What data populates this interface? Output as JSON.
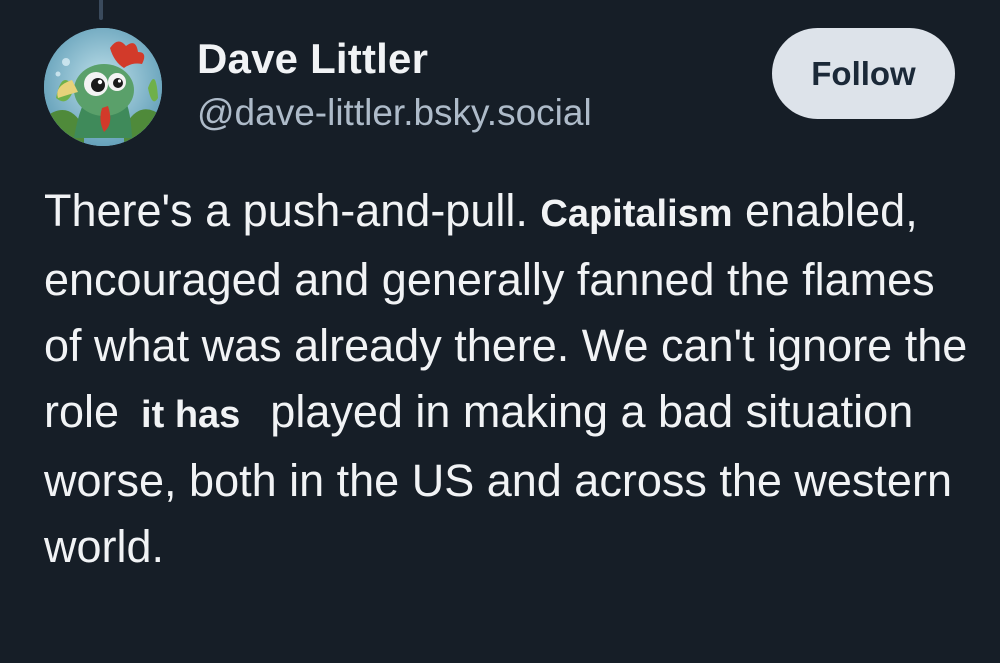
{
  "author": {
    "display_name": "Dave Littler",
    "handle": "@dave-littler.bsky.social"
  },
  "follow_button": {
    "label": "Follow"
  },
  "post": {
    "segments": [
      {
        "text": "There's a push-and-pull. ",
        "bold": false
      },
      {
        "text": "Capitalism",
        "bold": true
      },
      {
        "text": " enabled, encouraged and generally fanned the flames of what was already there. We can't ignore the role",
        "bold": false
      },
      {
        "text": "it has",
        "bold": true
      },
      {
        "text": "played in making a bad situation worse, both in the US and across the western world.",
        "bold": false
      }
    ]
  },
  "colors": {
    "background": "#161e27",
    "text": "#f1f3f5",
    "handle": "#aebbc9",
    "follow_button_bg": "#dde3ea",
    "follow_button_text": "#1b2938"
  },
  "icons": {
    "avatar": "cartoon-bird-avatar"
  }
}
